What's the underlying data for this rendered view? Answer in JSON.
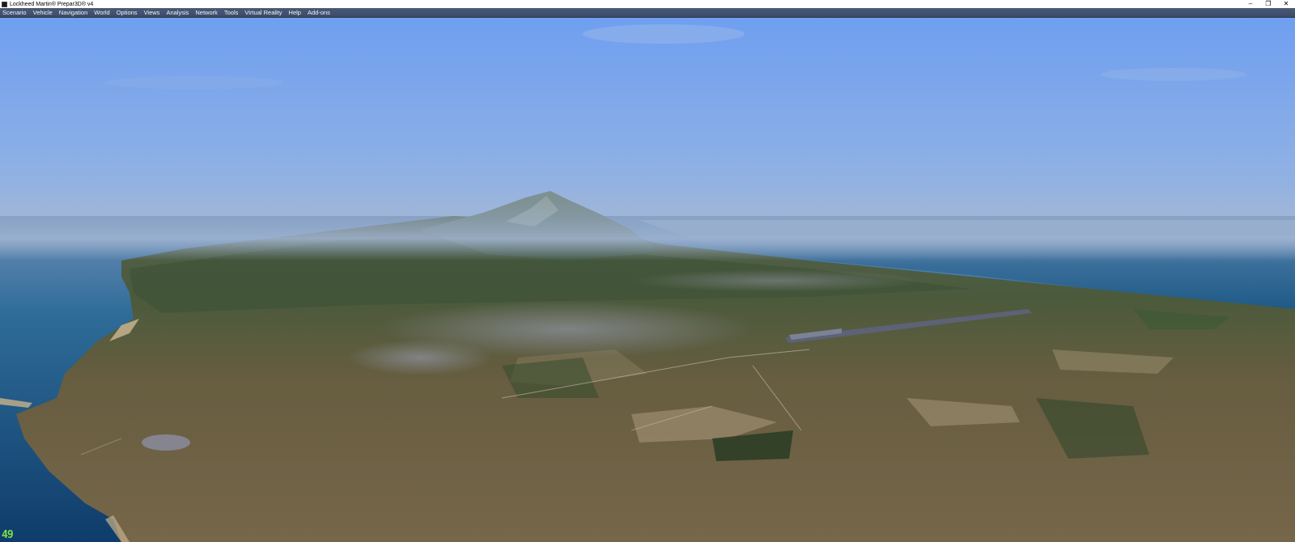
{
  "window": {
    "title": "Lockheed Martin® Prepar3D® v4",
    "controls": {
      "minimize": "–",
      "restore": "❐",
      "close": "✕"
    }
  },
  "menu": {
    "items": [
      {
        "label": "Scenario"
      },
      {
        "label": "Vehicle"
      },
      {
        "label": "Navigation"
      },
      {
        "label": "World"
      },
      {
        "label": "Options"
      },
      {
        "label": "Views"
      },
      {
        "label": "Analysis"
      },
      {
        "label": "Network"
      },
      {
        "label": "Tools"
      },
      {
        "label": "Virtual Reality"
      },
      {
        "label": "Help"
      },
      {
        "label": "Add-ons"
      }
    ]
  },
  "viewport": {
    "fps": "49",
    "colors": {
      "sky_top": "#6f9ff0",
      "sky_horizon": "#9fb6d8",
      "sea": "#1f5a86",
      "land": "#6e6346"
    }
  }
}
